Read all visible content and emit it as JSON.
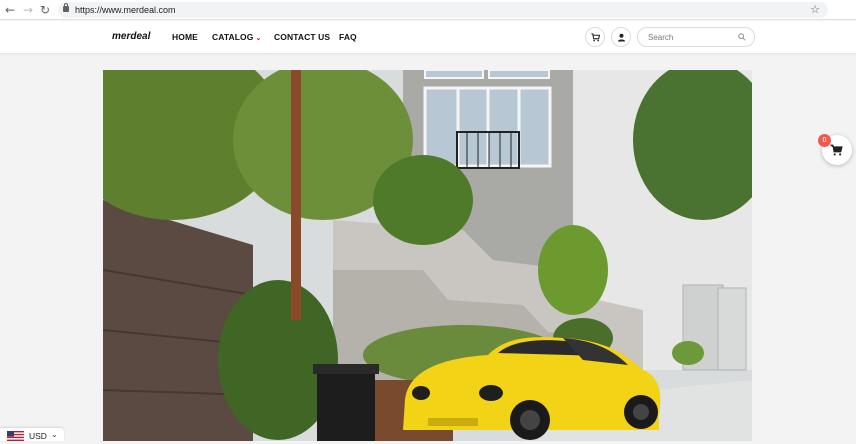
{
  "browser": {
    "url": "https://www.merdeal.com",
    "back_glyph": "←",
    "forward_glyph": "→",
    "reload_glyph": "↻",
    "star_glyph": "☆"
  },
  "header": {
    "logo": "merdeal",
    "nav": [
      {
        "label": "HOME"
      },
      {
        "label": "CATALOG",
        "has_dropdown": true,
        "caret": "⌄"
      },
      {
        "label": "CONTACT US"
      },
      {
        "label": "FAQ"
      }
    ],
    "search": {
      "placeholder": "Search",
      "value": ""
    },
    "accent_color": "#d0021b"
  },
  "hero": {
    "description_icon": "hero-photo",
    "subject_color": "#f2d316"
  },
  "cart": {
    "count": "0",
    "badge_color": "#ee5a4f"
  },
  "currency": {
    "code": "USD",
    "flag_icon": "us-flag-icon",
    "caret": "⌄"
  }
}
